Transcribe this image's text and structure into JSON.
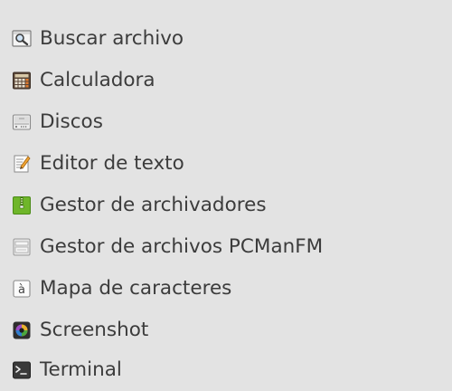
{
  "menu": {
    "items": [
      {
        "label": "Buscar archivo",
        "icon": "magnifier-icon"
      },
      {
        "label": "Calculadora",
        "icon": "calculator-icon"
      },
      {
        "label": "Discos",
        "icon": "disk-icon"
      },
      {
        "label": "Editor de texto",
        "icon": "text-editor-icon"
      },
      {
        "label": "Gestor de archivadores",
        "icon": "archive-manager-icon"
      },
      {
        "label": "Gestor de archivos PCManFM",
        "icon": "file-manager-icon"
      },
      {
        "label": "Mapa de caracteres",
        "icon": "character-map-icon"
      },
      {
        "label": "Screenshot",
        "icon": "screenshot-icon"
      },
      {
        "label": "Terminal",
        "icon": "terminal-icon"
      }
    ]
  },
  "colors": {
    "background": "#e3e3e3",
    "text": "#3c3c3c"
  }
}
